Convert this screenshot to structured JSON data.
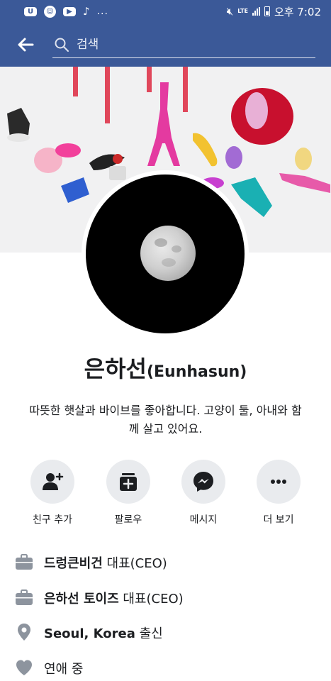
{
  "status_bar": {
    "app_icons": [
      "messenger-icon",
      "face-icon",
      "youtube-icon",
      "tiktok-icon"
    ],
    "dots": "...",
    "network": "LTE",
    "time": "오후 7:02"
  },
  "header": {
    "search_placeholder": "검색"
  },
  "profile": {
    "name": "은하선",
    "name_latin": "(Eunhasun)",
    "bio": "따뜻한 햇살과 바이브를 좋아합니다. 고양이 둘, 아내와 함께 살고 있어요."
  },
  "actions": [
    {
      "label": "친구 추가",
      "icon": "add-friend-icon"
    },
    {
      "label": "팔로우",
      "icon": "follow-icon"
    },
    {
      "label": "메시지",
      "icon": "messenger-icon"
    },
    {
      "label": "더 보기",
      "icon": "more-icon"
    }
  ],
  "info": {
    "work1": {
      "bold": "드렁큰비건",
      "rest": " 대표(CEO)"
    },
    "work2": {
      "bold": "은하선 토이즈",
      "rest": " 대표(CEO)"
    },
    "hometown": {
      "bold": "Seoul, Korea",
      "rest": " 출신"
    },
    "relationship": {
      "bold": "",
      "rest": "연애 중"
    }
  },
  "colors": {
    "brand": "#3b5998",
    "button_bg": "#e9ebee",
    "icon_gray": "#8d949e",
    "text": "#1c1e21"
  }
}
